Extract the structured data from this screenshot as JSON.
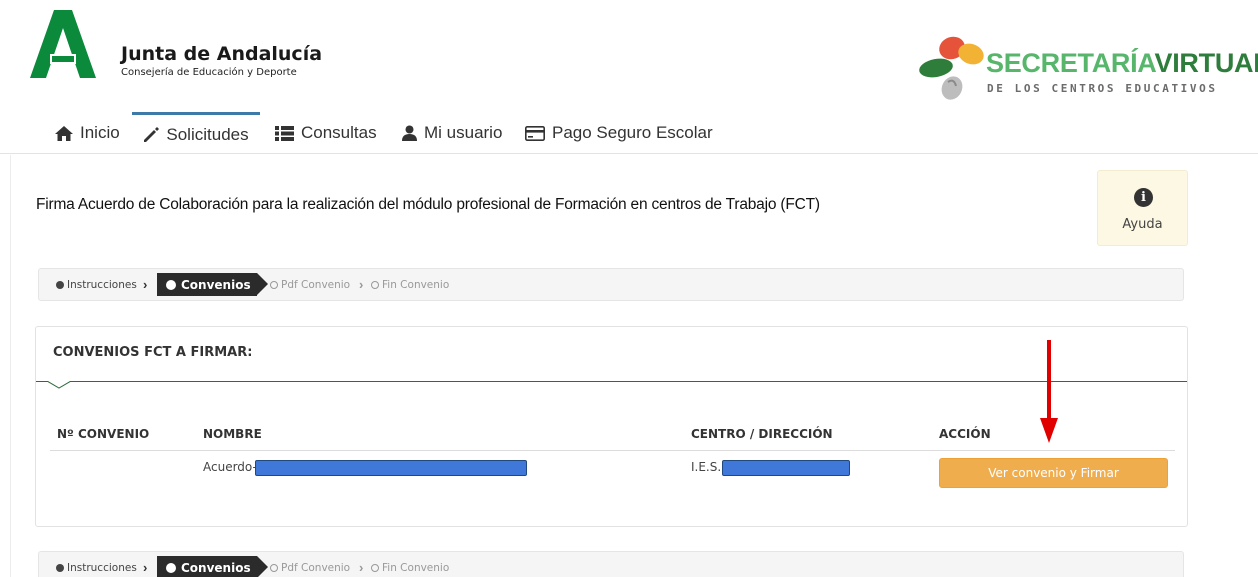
{
  "header": {
    "org_title": "Junta de Andalucía",
    "org_subtitle": "Consejería de Educación y Deporte",
    "brand_part1": "SECRETARÍA",
    "brand_part2": "VIRTUAL",
    "brand_subtitle": "DE LOS CENTROS EDUCATIVOS"
  },
  "nav": {
    "items": [
      {
        "label": "Inicio",
        "icon": "home-icon"
      },
      {
        "label": "Solicitudes",
        "icon": "pencil-icon",
        "active": true
      },
      {
        "label": "Consultas",
        "icon": "list-icon"
      },
      {
        "label": "Mi usuario",
        "icon": "user-icon"
      },
      {
        "label": "Pago Seguro Escolar",
        "icon": "credit-card-icon"
      }
    ]
  },
  "page": {
    "title": "Firma Acuerdo de Colaboración para la realización del módulo profesional de Formación en centros de Trabajo (FCT)",
    "help_label": "Ayuda",
    "help_icon": "info-icon"
  },
  "steps": [
    {
      "label": "Instrucciones",
      "state": "done"
    },
    {
      "label": "Convenios",
      "state": "active"
    },
    {
      "label": "Pdf Convenio",
      "state": "pending"
    },
    {
      "label": "Fin Convenio",
      "state": "pending"
    }
  ],
  "panel": {
    "title": "CONVENIOS FCT A FIRMAR:",
    "columns": [
      "Nº CONVENIO",
      "NOMBRE",
      "CENTRO / DIRECCIÓN",
      "ACCIÓN"
    ],
    "rows": [
      {
        "numero": "",
        "nombre_prefix": "Acuerdo-",
        "centro_prefix": "I.E.S.",
        "action_label": "Ver convenio y Firmar"
      }
    ]
  },
  "colors": {
    "accent_green": "#2e6a3c",
    "button_orange": "#f0ad4e",
    "help_bg": "#fcf8e3",
    "annotation_red": "#e00000",
    "redaction_blue": "#3f78d8"
  }
}
